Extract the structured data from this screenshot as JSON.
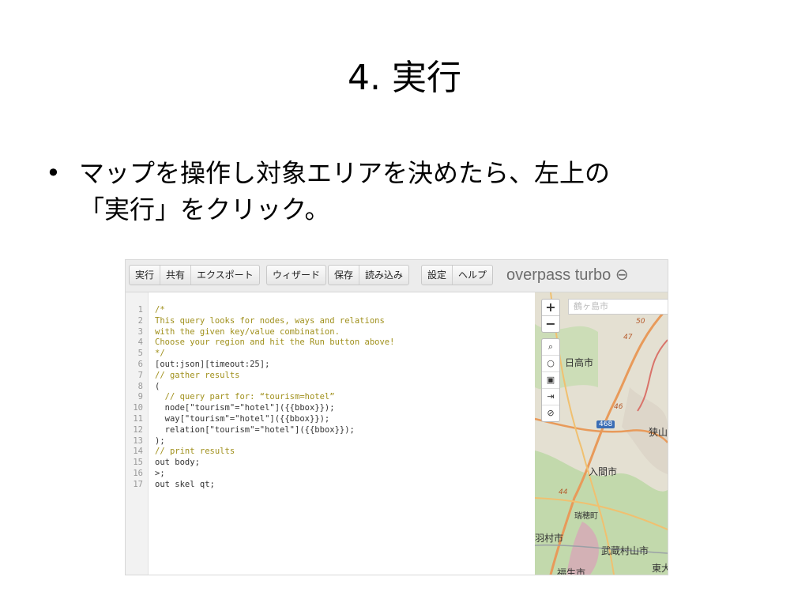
{
  "slide": {
    "title": "4. 実行",
    "bullet_symbol": "•",
    "bullet_line1": "マップを操作し対象エリアを決めたら、左上の",
    "bullet_line2": "「実行」をクリック。"
  },
  "toolbar": {
    "group1": [
      "実行",
      "共有",
      "エクスポート"
    ],
    "group2": [
      "ウィザード"
    ],
    "group3": [
      "保存",
      "読み込み"
    ],
    "group4": [
      "設定",
      "ヘルプ"
    ],
    "brand": "overpass turbo ⊖"
  },
  "editor": {
    "lines": [
      {
        "n": "1",
        "t": "/*",
        "c": "comment"
      },
      {
        "n": "2",
        "t": "This query looks for nodes, ways and relations",
        "c": "comment"
      },
      {
        "n": "3",
        "t": "with the given key/value combination.",
        "c": "comment"
      },
      {
        "n": "4",
        "t": "Choose your region and hit the Run button above!",
        "c": "comment"
      },
      {
        "n": "5",
        "t": "*/",
        "c": "comment"
      },
      {
        "n": "6",
        "t": "[out:json][timeout:25];",
        "c": "plain"
      },
      {
        "n": "7",
        "t": "// gather results",
        "c": "comment"
      },
      {
        "n": "8",
        "t": "(",
        "c": "plain"
      },
      {
        "n": "9",
        "t": "  // query part for: “tourism=hotel”",
        "c": "comment"
      },
      {
        "n": "10",
        "t": "  node[\"tourism\"=\"hotel\"]({{bbox}});",
        "c": "plain"
      },
      {
        "n": "11",
        "t": "  way[\"tourism\"=\"hotel\"]({{bbox}});",
        "c": "plain"
      },
      {
        "n": "12",
        "t": "  relation[\"tourism\"=\"hotel\"]({{bbox}});",
        "c": "plain"
      },
      {
        "n": "13",
        "t": ");",
        "c": "plain"
      },
      {
        "n": "14",
        "t": "// print results",
        "c": "comment"
      },
      {
        "n": "15",
        "t": "out body;",
        "c": "plain"
      },
      {
        "n": "16",
        "t": ">;",
        "c": "plain"
      },
      {
        "n": "17",
        "t": "out skel qt;",
        "c": "plain"
      }
    ]
  },
  "map": {
    "zoom_in": "+",
    "zoom_out": "−",
    "tools": [
      "⌕",
      "○",
      "▣",
      "⇥",
      "⊘"
    ],
    "search_text": "鶴ヶ島市",
    "places": [
      "日高市",
      "入間市",
      "狭山",
      "瑞穂町",
      "武蔵村山市",
      "羽村市",
      "福生市",
      "東大"
    ],
    "route_numbers": [
      "50",
      "47",
      "46",
      "44"
    ],
    "shield_numbers": [
      "468"
    ]
  },
  "colors": {
    "comment": "#a0901c",
    "map_road": "#e89a5a",
    "map_green": "#b9d7a2",
    "map_urban": "#ddd6c9"
  }
}
